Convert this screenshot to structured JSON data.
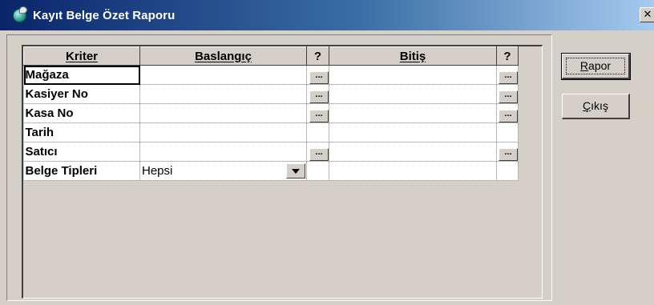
{
  "window": {
    "title": "Kayıt Belge Özet Raporu",
    "close_glyph": "✕"
  },
  "grid": {
    "headers": {
      "criterion": "Kriter",
      "start": "Baslangıç",
      "start_help": "?",
      "end": "Bitiş",
      "end_help": "?"
    },
    "dots_label": "...",
    "rows": [
      {
        "criterion": "Mağaza",
        "start": "",
        "end": "",
        "start_button": true,
        "end_button": true
      },
      {
        "criterion": "Kasiyer No",
        "start": "",
        "end": "",
        "start_button": true,
        "end_button": true
      },
      {
        "criterion": "Kasa No",
        "start": "",
        "end": "",
        "start_button": true,
        "end_button": true
      },
      {
        "criterion": "Tarih",
        "start": "",
        "end": "",
        "start_button": false,
        "end_button": false
      },
      {
        "criterion": "Satıcı",
        "start": "",
        "end": "",
        "start_button": true,
        "end_button": true
      },
      {
        "criterion": "Belge Tipleri",
        "start": "Hepsi",
        "end": "",
        "start_button": false,
        "end_button": false,
        "combo": true
      }
    ]
  },
  "buttons": {
    "report": {
      "label_first": "R",
      "label_rest": "apor"
    },
    "exit": {
      "label_first": "Ç",
      "label_rest": "ıkış"
    }
  },
  "icons": {
    "app": "app-globe-icon",
    "dropdown": "chevron-down-icon"
  }
}
